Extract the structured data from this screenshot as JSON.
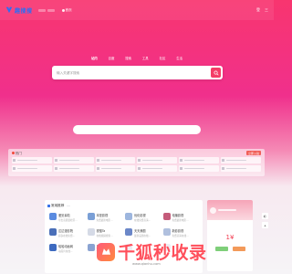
{
  "header": {
    "logo_text": "趣搜搜",
    "nav_home": "首页",
    "right_items": [
      "登",
      "三"
    ]
  },
  "search": {
    "tabs": [
      "站内",
      "百度",
      "搜索",
      "工具",
      "社区",
      "生活"
    ],
    "active_tab": 0,
    "placeholder": "输入关键字搜索"
  },
  "hot": {
    "title": "热门",
    "tag": "立即入驻"
  },
  "favorites": {
    "title": "常用推荐",
    "tabs": [
      "",
      "",
      "",
      "",
      "",
      "",
      "",
      "",
      "",
      ""
    ],
    "sites": [
      {
        "name": "爱妥素啦",
        "desc": "导出高质量社区..."
      },
      {
        "name": "本是影视",
        "desc": "免费最新电影..."
      },
      {
        "name": "优化影视",
        "desc": "在线免费高清..."
      },
      {
        "name": "电播影视",
        "desc": "免费最新电影..."
      },
      {
        "name": "达达漫影院",
        "desc": "超多在线免费..."
      },
      {
        "name": "视搜Ta",
        "desc": "在线视频搜索..."
      },
      {
        "name": "天天美剧",
        "desc": "最新美剧在线..."
      },
      {
        "name": "新影影视",
        "desc": "免费高清在线..."
      },
      {
        "name": "哈哈动画网",
        "desc": "动画片在线..."
      },
      {
        "name": "贝影影视",
        "desc": "一站式全网..."
      },
      {
        "name": "",
        "desc": ""
      },
      {
        "name": "",
        "desc": ""
      }
    ]
  },
  "watermark": {
    "text": "千狐秒收录",
    "url": "www.qianhu.com"
  },
  "side": {
    "big_value": "1¥"
  },
  "colors": {
    "accent": "#f43d67",
    "brand_blue": "#2b6ef5",
    "watermark": "#ff4f5b"
  }
}
